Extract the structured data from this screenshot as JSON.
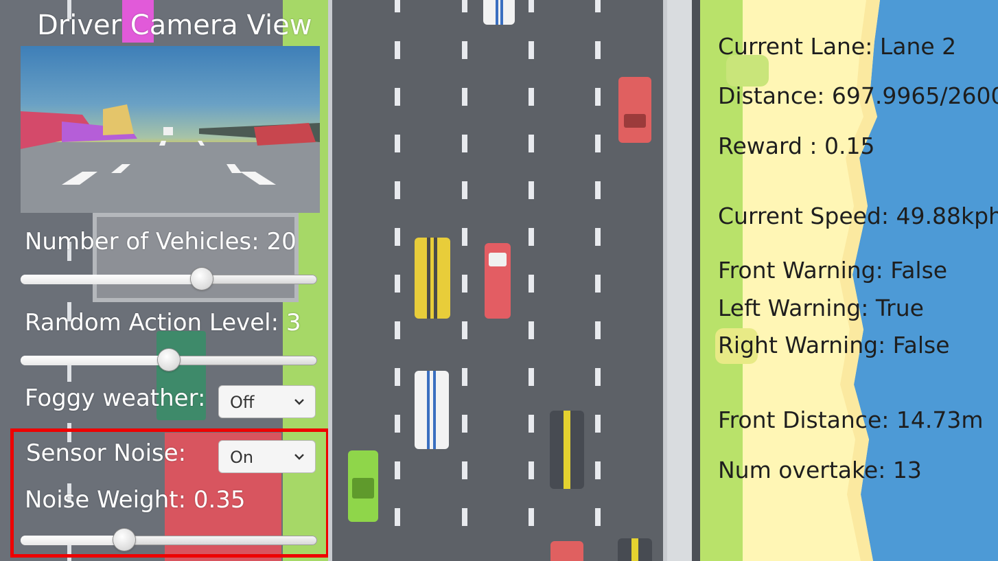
{
  "camera": {
    "title": "Driver Camera View"
  },
  "controls": {
    "vehicles": {
      "label": "Number of Vehicles: 20",
      "value": 20,
      "fraction": 0.61
    },
    "random_action": {
      "label": "Random Action Level: 3",
      "value": 3,
      "fraction": 0.5
    },
    "fog": {
      "label": "Foggy weather:",
      "selected": "Off"
    },
    "sensor_noise": {
      "label": "Sensor Noise:",
      "selected": "On"
    },
    "noise_weight": {
      "label": "Noise Weight:  0.35",
      "value": 0.35,
      "fraction": 0.35
    }
  },
  "hud": {
    "current_lane": "Current Lane: Lane 2",
    "distance": "Distance: 697.9965/2600",
    "reward": "Reward : 0.15",
    "current_speed": "Current Speed: 49.88kph",
    "front_warning": "Front Warning: False",
    "left_warning": "Left Warning: True",
    "right_warning": "Right Warning: False",
    "front_distance": "Front Distance: 14.73m",
    "num_overtake": "Num overtake: 13"
  },
  "colors": {
    "highlight": "#e00000",
    "grass": "#b9e26a",
    "sand": "#fff3b0",
    "sea": "#4d9ad6",
    "road": "#5d6167"
  },
  "icons": {
    "dropdown": "chevron-down-icon"
  }
}
